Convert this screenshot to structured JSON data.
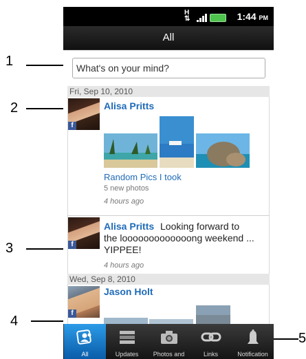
{
  "status_bar": {
    "time": "1:44",
    "ampm": "PM"
  },
  "title": "All",
  "status_input": {
    "placeholder": "What's on your mind?"
  },
  "feed": {
    "date1": "Fri, Sep 10, 2010",
    "post1": {
      "name": "Alisa Pritts",
      "album_title": "Random Pics I took",
      "meta": "5 new photos",
      "time": "4 hours ago"
    },
    "post2": {
      "name": "Alisa Pritts",
      "text": "Looking forward to the looooooooooooong weekend ... YIPPEE!",
      "time": "4 hours ago"
    },
    "date2": "Wed, Sep 8, 2010",
    "post3": {
      "name": "Jason Holt"
    }
  },
  "tabs": [
    {
      "label": "All",
      "icon": "people-icon"
    },
    {
      "label": "Updates",
      "icon": "updates-icon"
    },
    {
      "label": "Photos and",
      "icon": "camera-icon"
    },
    {
      "label": "Links",
      "icon": "link-icon"
    },
    {
      "label": "Notification",
      "icon": "bell-icon"
    }
  ],
  "callouts": [
    "1",
    "2",
    "3",
    "4",
    "5"
  ],
  "colors": {
    "accent": "#1f6bb8",
    "tab_active": "#1a7fd0",
    "facebook": "#3b5998"
  }
}
